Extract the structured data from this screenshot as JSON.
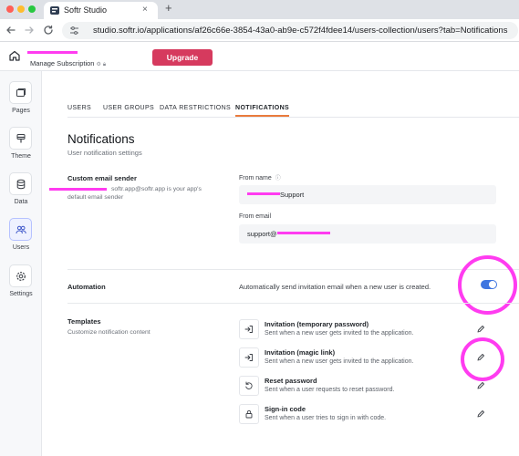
{
  "browser": {
    "tab_title": "Softr Studio",
    "tab_close": "×",
    "new_tab": "+",
    "url": "studio.softr.io/applications/af26c66e-3854-43a0-ab9e-c572f4fdee14/users-collection/users?tab=Notifications"
  },
  "header": {
    "manage_subscription": "Manage Subscription",
    "upgrade_label": "Upgrade"
  },
  "sidebar": {
    "items": [
      {
        "label": "Pages",
        "icon": "pages-icon"
      },
      {
        "label": "Theme",
        "icon": "theme-icon"
      },
      {
        "label": "Data",
        "icon": "database-icon"
      },
      {
        "label": "Users",
        "icon": "users-icon",
        "active": true
      },
      {
        "label": "Settings",
        "icon": "settings-icon"
      }
    ]
  },
  "tabs": [
    {
      "label": "USERS"
    },
    {
      "label": "USER GROUPS"
    },
    {
      "label": "DATA RESTRICTIONS"
    },
    {
      "label": "NOTIFICATIONS",
      "active": true
    }
  ],
  "page": {
    "title": "Notifications",
    "subtitle": "User notification settings"
  },
  "sender": {
    "label": "Custom email sender",
    "desc_line1": "softr.app@softr.app is your app's",
    "desc_line2": "default email sender",
    "from_name_label": "From name",
    "from_name_value": "Support",
    "from_email_label": "From email",
    "from_email_value": "support@"
  },
  "automation": {
    "label": "Automation",
    "description": "Automatically send invitation email when a new user is created.",
    "enabled": true
  },
  "templates": {
    "label": "Templates",
    "description": "Customize notification content",
    "items": [
      {
        "title": "Invitation (temporary password)",
        "desc": "Sent when a new user gets invited to the application.",
        "icon": "login-arrow-icon"
      },
      {
        "title": "Invitation (magic link)",
        "desc": "Sent when a new user gets invited to the application.",
        "icon": "login-arrow-icon"
      },
      {
        "title": "Reset password",
        "desc": "Sent when a user requests to reset password.",
        "icon": "reset-icon"
      },
      {
        "title": "Sign-in code",
        "desc": "Sent when a user tries to sign in with code.",
        "icon": "lock-icon"
      }
    ]
  },
  "colors": {
    "upgrade": "#d63a5e",
    "toggle_on": "#3e75e0",
    "active_tab_underline": "#e97b3d",
    "annotation": "#ff3cf0"
  }
}
